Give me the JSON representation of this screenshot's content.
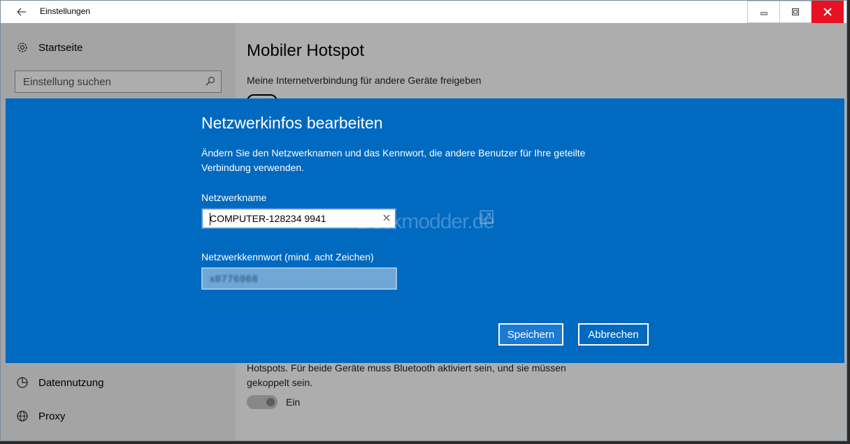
{
  "window": {
    "title": "Einstellungen",
    "icons": {
      "back": "back-arrow-icon",
      "minimize": "minimize-icon",
      "restore": "restore-icon",
      "close": "close-icon"
    }
  },
  "sidebar": {
    "home_label": "Startseite",
    "search_placeholder": "Einstellung suchen",
    "items": [
      {
        "label": "Datennutzung",
        "icon": "data-usage-icon"
      },
      {
        "label": "Proxy",
        "icon": "globe-icon"
      }
    ]
  },
  "main": {
    "title": "Mobiler Hotspot",
    "share_label": "Meine Internetverbindung für andere Geräte freigeben",
    "bluetooth_desc": "Hotspots. Für beide Geräte muss Bluetooth aktiviert sein, und sie müssen gekoppelt sein.",
    "bluetooth_toggle_label": "Ein"
  },
  "dialog": {
    "title": "Netzwerkinfos bearbeiten",
    "description": "Ändern Sie den Netzwerknamen und das Kennwort, die andere Benutzer für Ihre geteilte Verbindung verwenden.",
    "network_name_label": "Netzwerkname",
    "network_name_value": "COMPUTER-128234 9941",
    "password_label": "Netzwerkkennwort (mind. acht Zeichen)",
    "password_value": "x8776968",
    "save_label": "Speichern",
    "cancel_label": "Abbrechen"
  },
  "watermark": "Deskmodder.de",
  "colors": {
    "dialog_bg": "#0069c0",
    "close_btn": "#e81123"
  }
}
